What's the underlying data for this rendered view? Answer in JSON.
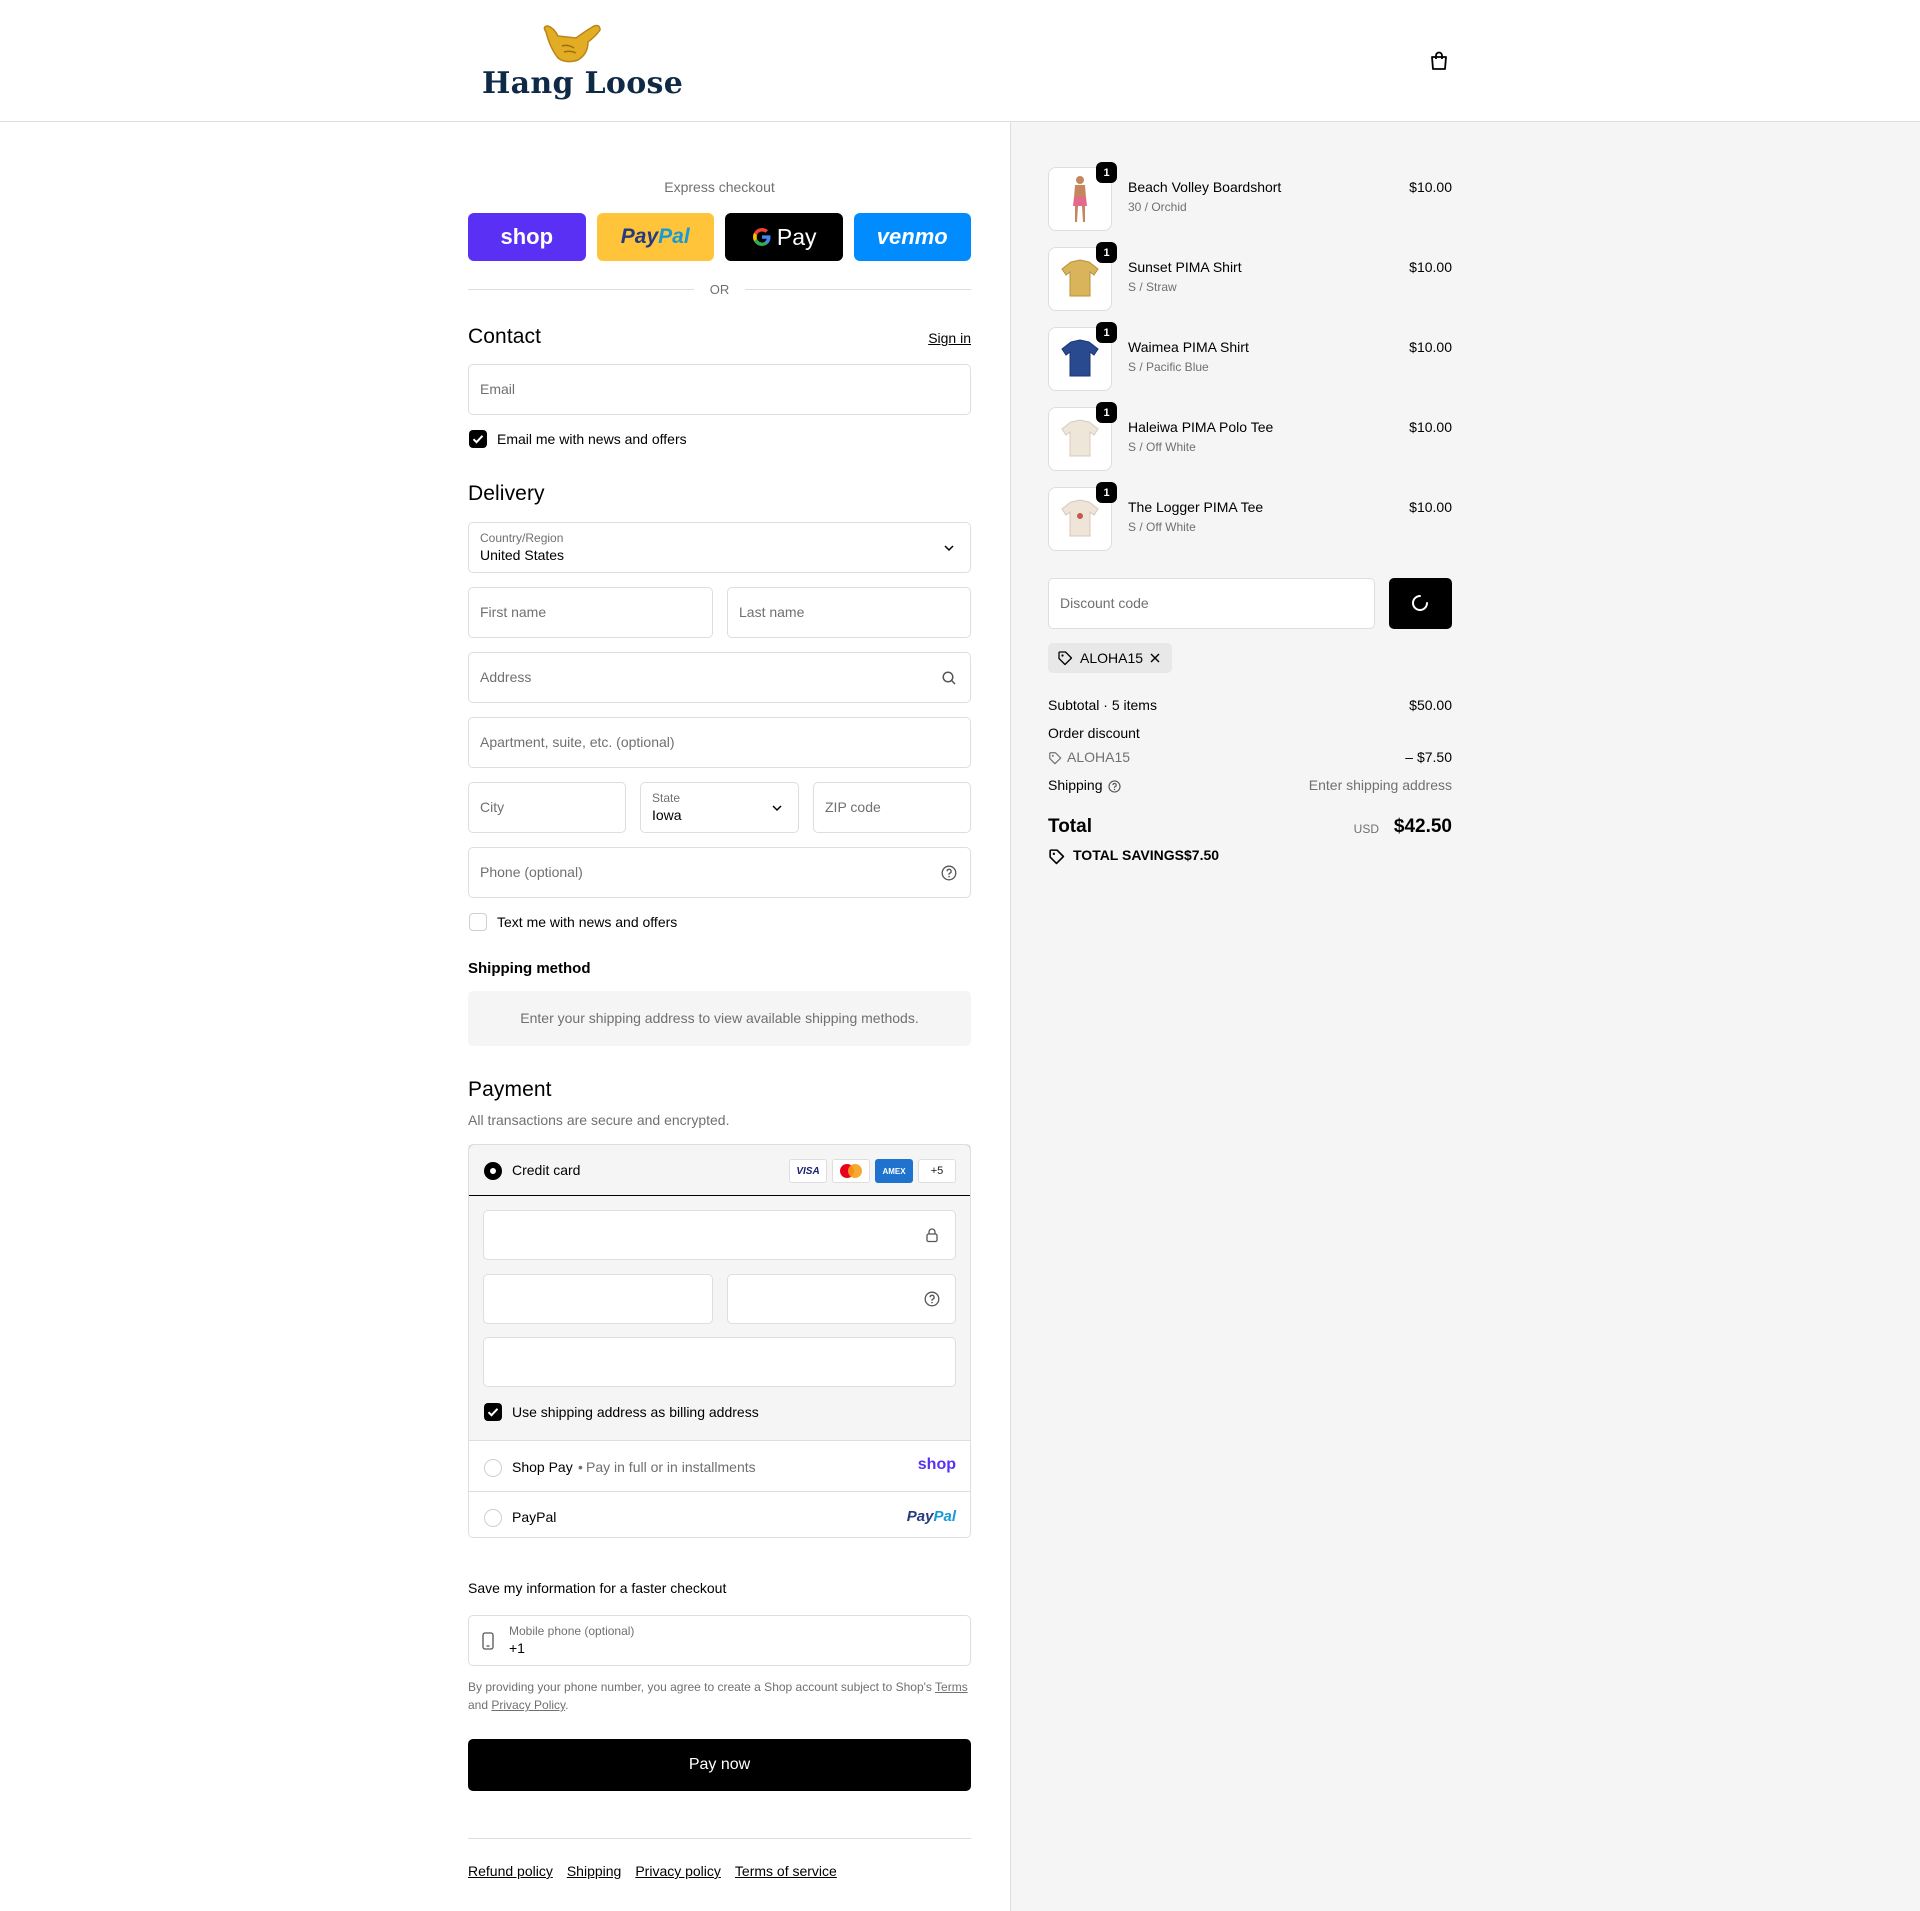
{
  "header": {
    "logo_text": "Hang Loose",
    "cart_icon": "shopping-bag-icon"
  },
  "express": {
    "title": "Express checkout",
    "shop_label": "shop",
    "paypal_label_1": "Pay",
    "paypal_label_2": "Pal",
    "gpay_label": "Pay",
    "venmo_label": "venmo",
    "or_label": "OR"
  },
  "contact": {
    "heading": "Contact",
    "sign_in": "Sign in",
    "email_placeholder": "Email",
    "news_label": "Email me with news and offers",
    "news_checked": true
  },
  "delivery": {
    "heading": "Delivery",
    "country_label": "Country/Region",
    "country_value": "United States",
    "first_name": "First name",
    "last_name": "Last name",
    "address": "Address",
    "apartment": "Apartment, suite, etc. (optional)",
    "city": "City",
    "state_label": "State",
    "state_value": "Iowa",
    "zip": "ZIP code",
    "phone": "Phone (optional)",
    "text_label": "Text me with news and offers",
    "text_checked": false
  },
  "shipping_method": {
    "heading": "Shipping method",
    "message": "Enter your shipping address to view available shipping methods."
  },
  "payment": {
    "heading": "Payment",
    "subtitle": "All transactions are secure and encrypted.",
    "credit_card_label": "Credit card",
    "brands": [
      "VISA",
      "",
      "AMEX",
      "+5"
    ],
    "billing_label": "Use shipping address as billing address",
    "shop_pay_label": "Shop Pay",
    "shop_pay_sub": "Pay in full or in installments",
    "shop_pay_logo": "shop",
    "paypal_label": "PayPal",
    "paypal_logo_1": "Pay",
    "paypal_logo_2": "Pal"
  },
  "save_info": {
    "heading": "Save my information for a faster checkout",
    "mobile_label": "Mobile phone (optional)",
    "mobile_value": "+1",
    "legal_1": "By providing your phone number, you agree to create a Shop account subject to Shop's",
    "terms": "Terms",
    "legal_2": "and",
    "privacy": "Privacy Policy",
    "legal_3": "."
  },
  "pay_now": "Pay now",
  "footer": {
    "links": [
      "Refund policy",
      "Shipping",
      "Privacy policy",
      "Terms of service"
    ]
  },
  "summary": {
    "items": [
      {
        "name": "Beach Volley Boardshort",
        "variant": "30 / Orchid",
        "price": "$10.00",
        "qty": "1",
        "color": "#e36a8c"
      },
      {
        "name": "Sunset PIMA Shirt",
        "variant": "S / Straw",
        "price": "$10.00",
        "qty": "1",
        "color": "#d9b45a"
      },
      {
        "name": "Waimea PIMA Shirt",
        "variant": "S / Pacific Blue",
        "price": "$10.00",
        "qty": "1",
        "color": "#2a4a8f"
      },
      {
        "name": "Haleiwa PIMA Polo Tee",
        "variant": "S / Off White",
        "price": "$10.00",
        "qty": "1",
        "color": "#efe6da"
      },
      {
        "name": "The Logger PIMA Tee",
        "variant": "S / Off White",
        "price": "$10.00",
        "qty": "1",
        "color": "#eee5d8"
      }
    ],
    "discount_placeholder": "Discount code",
    "applied_code": "ALOHA15",
    "subtotal_label": "Subtotal · 5 items",
    "subtotal_value": "$50.00",
    "order_discount_label": "Order discount",
    "discount_code": "ALOHA15",
    "discount_value": "– $7.50",
    "shipping_label": "Shipping",
    "shipping_value": "Enter shipping address",
    "total_label": "Total",
    "currency": "USD",
    "total_value": "$42.50",
    "savings_label": "TOTAL SAVINGS",
    "savings_value": "$7.50"
  }
}
